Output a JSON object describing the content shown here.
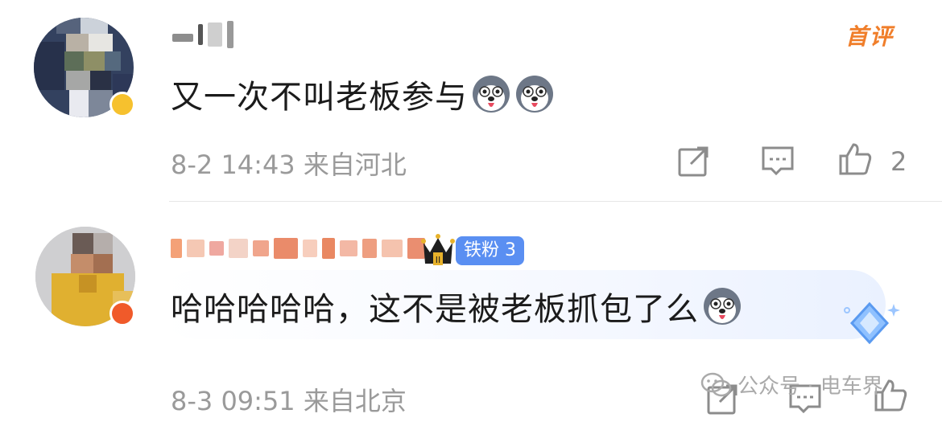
{
  "comments": [
    {
      "text": "又一次不叫老板参与",
      "emoji_count": 2,
      "emoji_icon": "husky-dog-emoji-icon",
      "meta": "8-2 14:43 来自河北",
      "first_badge": "首评",
      "like_count": "2"
    },
    {
      "text": "哈哈哈哈哈，这不是被老板抓包了么",
      "emoji_count": 1,
      "emoji_icon": "husky-dog-emoji-icon",
      "fan_badge": "铁粉 3",
      "meta": "8-3 09:51 来自北京"
    }
  ],
  "watermark": "公众号 · 电车界",
  "colors": {
    "first_badge": "#f07e2a",
    "fan_badge": "#5a8ff2",
    "meta_text": "#9a9a9a",
    "comment_text": "#1b1b1b"
  },
  "icons": [
    "share-icon",
    "comment-icon",
    "like-icon",
    "crown-icon",
    "gem-icon",
    "wechat-icon"
  ]
}
